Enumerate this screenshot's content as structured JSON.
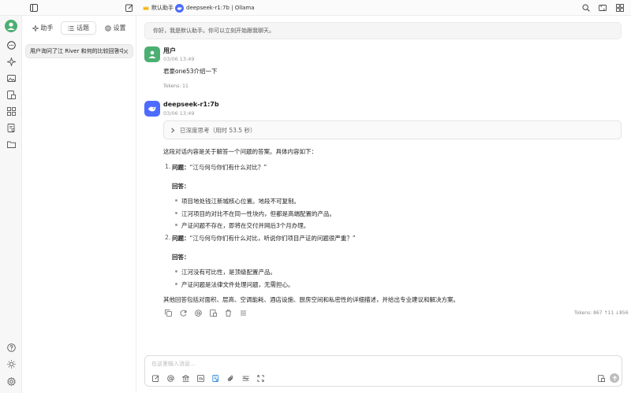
{
  "titlebar": {
    "assistant_label": "默认助手",
    "model_label": "deepseek-r1:7b | Ollama"
  },
  "panel": {
    "tabs": [
      {
        "label": "助手",
        "icon": "sparkle-icon"
      },
      {
        "label": "话题",
        "icon": "list-icon",
        "active": true
      },
      {
        "label": "设置",
        "icon": "gear-icon"
      }
    ],
    "topics": [
      {
        "title": "用户询问了江 River 和何的比较回答中"
      }
    ]
  },
  "chat": {
    "greeting": "你好，我是默认助手。你可以立刻开始跟我聊天。",
    "user_message": {
      "name": "用户",
      "time": "03/06 13:49",
      "text": "君豪one53介绍一下",
      "tokens": "Tokens: 11"
    },
    "assistant_message": {
      "name": "deepseek-r1:7b",
      "time": "03/06 13:49",
      "thinking": "已深度思考（用时 53.5 秒）",
      "intro": "这段对话内容是关于解答一个问题的答案。具体内容如下：",
      "items": [
        {
          "number": "1.",
          "question_label": "问题：",
          "question": "“江与何与你们有什么对比？”",
          "answer_label": "回答：",
          "points": [
            "项目地处钱江新城核心位置。地段不可复制。",
            "江河项目的对比不在同一性块内，但都是高端配置的产品。",
            "产证问题不存在，即将在交付并网后3个月办理。"
          ]
        },
        {
          "number": "2.",
          "question_label": "问题：",
          "question": "“江与何与你们有什么对比，听说你们项目产证的问题很严重？”",
          "answer_label": "回答：",
          "points": [
            "江河没有可比性，是顶级配置产品。",
            "产证问题是法律文件处理问题，无需担心。"
          ]
        }
      ],
      "conclusion": "其他回答包括对面积、层高、空调能耗、酒店设施、厨房空间和私密性的详细描述，并给出专业建议和解决方案。",
      "tokens": "Tokens: 867 ↑11 ↓856"
    }
  },
  "input": {
    "placeholder": "在这里输入消息..."
  },
  "colors": {
    "user_avatar": "#4caf72",
    "assistant_avatar": "#4d6bfe",
    "accent": "#1a7fe0"
  }
}
